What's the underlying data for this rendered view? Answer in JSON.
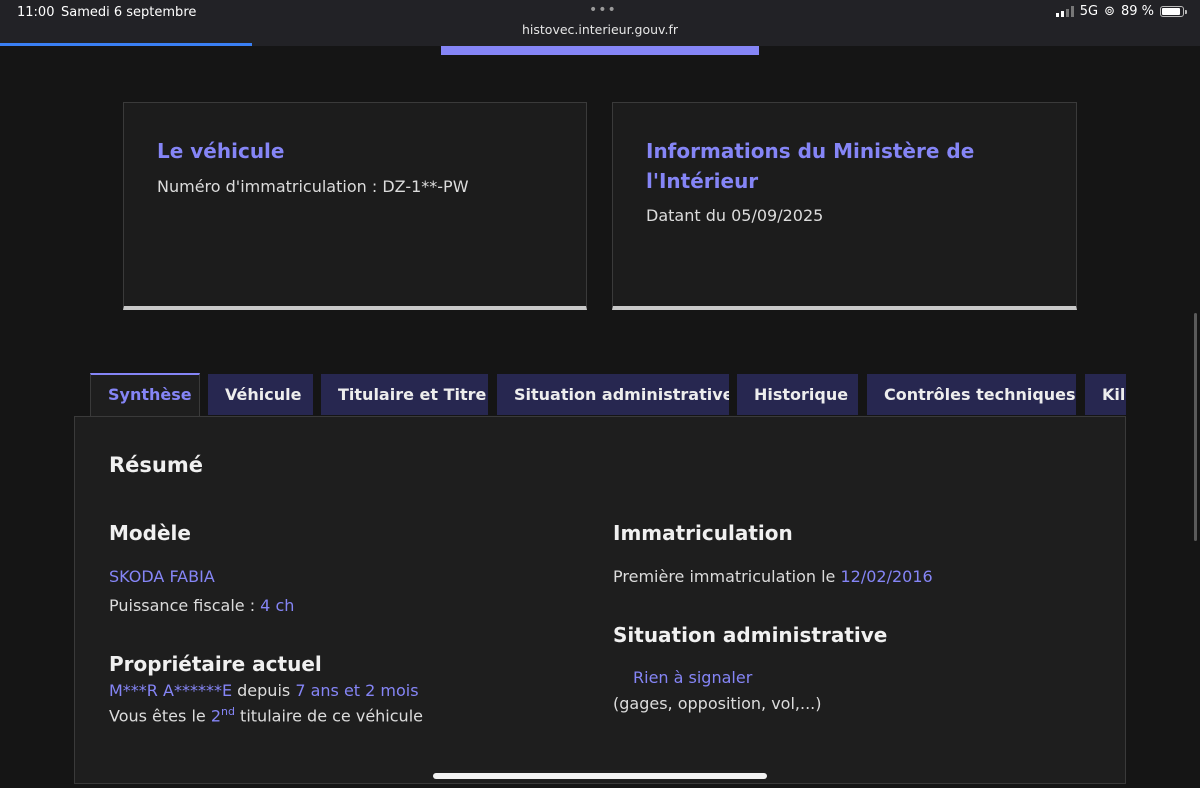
{
  "status_bar": {
    "time": "11:00",
    "date": "Samedi 6 septembre",
    "url": "histovec.interieur.gouv.fr",
    "network": "5G",
    "battery": "89 %",
    "battery_level": 0.89,
    "load_progress": 0.21
  },
  "cards": {
    "vehicle": {
      "title": "Le véhicule",
      "text": "Numéro d'immatriculation : DZ-1**-PW"
    },
    "ministry": {
      "title": "Informations du Ministère de l'Intérieur",
      "text": "Datant du 05/09/2025"
    }
  },
  "tabs": [
    "Synthèse",
    "Véhicule",
    "Titulaire et Titre",
    "Situation administrative",
    "Historique",
    "Contrôles techniques",
    "Kilométrage"
  ],
  "summary": {
    "title": "Résumé",
    "model": {
      "heading": "Modèle",
      "name": "SKODA FABIA",
      "fiscal_label": "Puissance fiscale : ",
      "fiscal_value": "4 ch"
    },
    "owner": {
      "heading": "Propriétaire actuel",
      "name": "M***R A******E",
      "since_label": " depuis ",
      "since_value": "7 ans et 2 mois",
      "rank_prefix": "Vous êtes le ",
      "rank_number": "2",
      "rank_suffix": "nd",
      "rank_rest": " titulaire de ce véhicule"
    },
    "registration": {
      "heading": "Immatriculation",
      "label": "Première immatriculation le ",
      "date": "12/02/2016"
    },
    "admin": {
      "heading": "Situation administrative",
      "status": "Rien à signaler",
      "detail": "(gages, opposition, vol,...)"
    }
  },
  "colors": {
    "accent": "#8585f6",
    "background": "#151515",
    "tab_background": "#272750"
  }
}
